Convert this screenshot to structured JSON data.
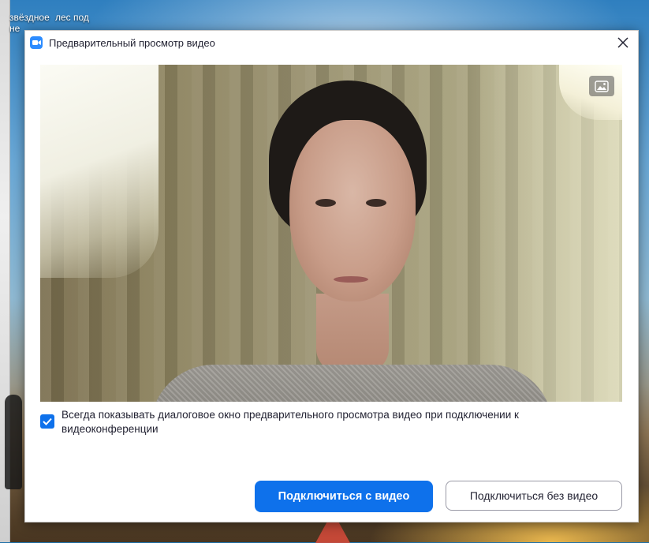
{
  "desktop": {
    "icon_labels": [
      "звёздное",
      "лес под",
      "не"
    ]
  },
  "dialog": {
    "title": "Предварительный просмотр видео",
    "close_glyph": "✕",
    "always_show_label": "Всегда показывать диалоговое окно предварительного просмотра видео при подключении к видеоконференции",
    "always_show_checked": true,
    "join_with_video_label": "Подключиться с видео",
    "join_without_video_label": "Подключиться без видео"
  },
  "icons": {
    "app": "zoom-camera-icon",
    "background": "virtual-background-icon",
    "close": "close-icon",
    "check": "check-icon"
  },
  "colors": {
    "accent": "#0e71eb",
    "app_icon": "#2d8cff"
  }
}
